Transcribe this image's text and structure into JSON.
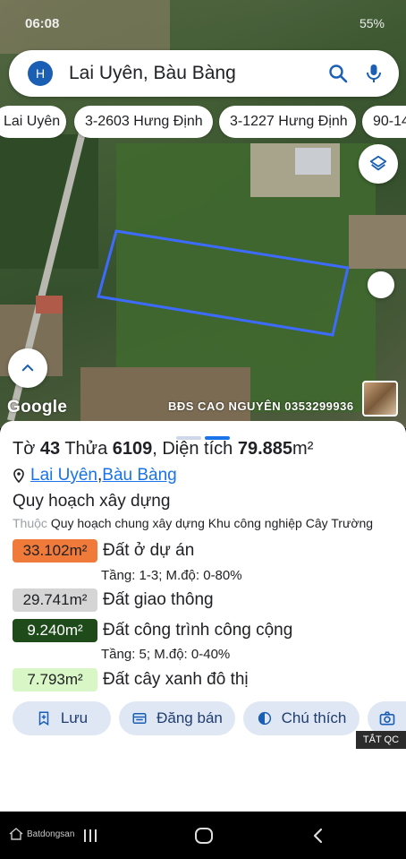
{
  "status": {
    "time": "06:08",
    "battery": "55%"
  },
  "search": {
    "avatar_letter": "H",
    "query": "Lai Uyên, Bàu Bàng"
  },
  "chips": [
    "Lai Uyên",
    "3-2603 Hưng Định",
    "3-1227 Hưng Định",
    "90-14"
  ],
  "map": {
    "google_label": "Google",
    "watermark": "BĐS CAO NGUYÊN 0353299936",
    "parcel_color": "#3d6bff"
  },
  "sheet": {
    "title_prefix": "Tờ ",
    "sheet_no": "43",
    "parcel_label": " Thửa ",
    "parcel_no": "6109",
    "area_label": ", Diện tích ",
    "area_value": "79.885",
    "area_unit": "m²",
    "location": {
      "ward": "Lai Uyên",
      "sep": ", ",
      "district": "Bàu Bàng"
    },
    "heading": "Quy hoạch xây dựng",
    "plan_prefix": "Thuộc ",
    "plan_name": "Quy hoạch chung xây dựng Khu công nghiệp Cây Trường",
    "zones": [
      {
        "area": "33.102m²",
        "label": "Đất ở dự án",
        "detail": "Tầng: 1-3; M.độ: 0-80%",
        "bg": "#f07a3a",
        "fg": "#202124"
      },
      {
        "area": "29.741m²",
        "label": "Đất giao thông",
        "detail": "",
        "bg": "#d5d5d5",
        "fg": "#202124"
      },
      {
        "area": "9.240m²",
        "label": "Đất công trình công cộng",
        "detail": "Tầng: 5; M.độ: 0-40%",
        "bg": "#1f4a1a",
        "fg": "#ffffff"
      },
      {
        "area": "7.793m²",
        "label": "Đất cây xanh đô thị",
        "detail": "",
        "bg": "#d9f7c6",
        "fg": "#202124"
      }
    ],
    "actions": [
      "Lưu",
      "Đăng bán",
      "Chú thích",
      ""
    ],
    "ad_label": "TẮT QC"
  },
  "navbar": {
    "brand": "Batdongsan"
  }
}
